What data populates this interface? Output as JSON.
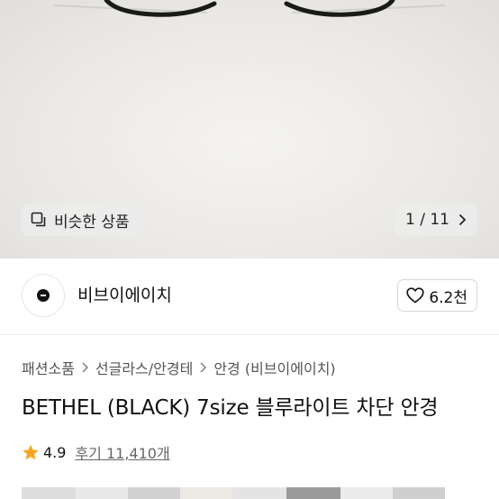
{
  "hero": {
    "similar_label": "비슷한 상품",
    "pager": "1 / 11"
  },
  "brand": {
    "name": "비브이에이치",
    "likes": "6.2천"
  },
  "breadcrumb": [
    "패션소품",
    "선글라스/안경테",
    "안경 (비브이에이치)"
  ],
  "product": {
    "title": "BETHEL (BLACK) 7size 블루라이트 차단 안경",
    "rating": "4.9",
    "reviews": "후기 11,410개"
  },
  "colors": {
    "star": "#f5a623",
    "text": "#111111",
    "muted": "#666666"
  }
}
